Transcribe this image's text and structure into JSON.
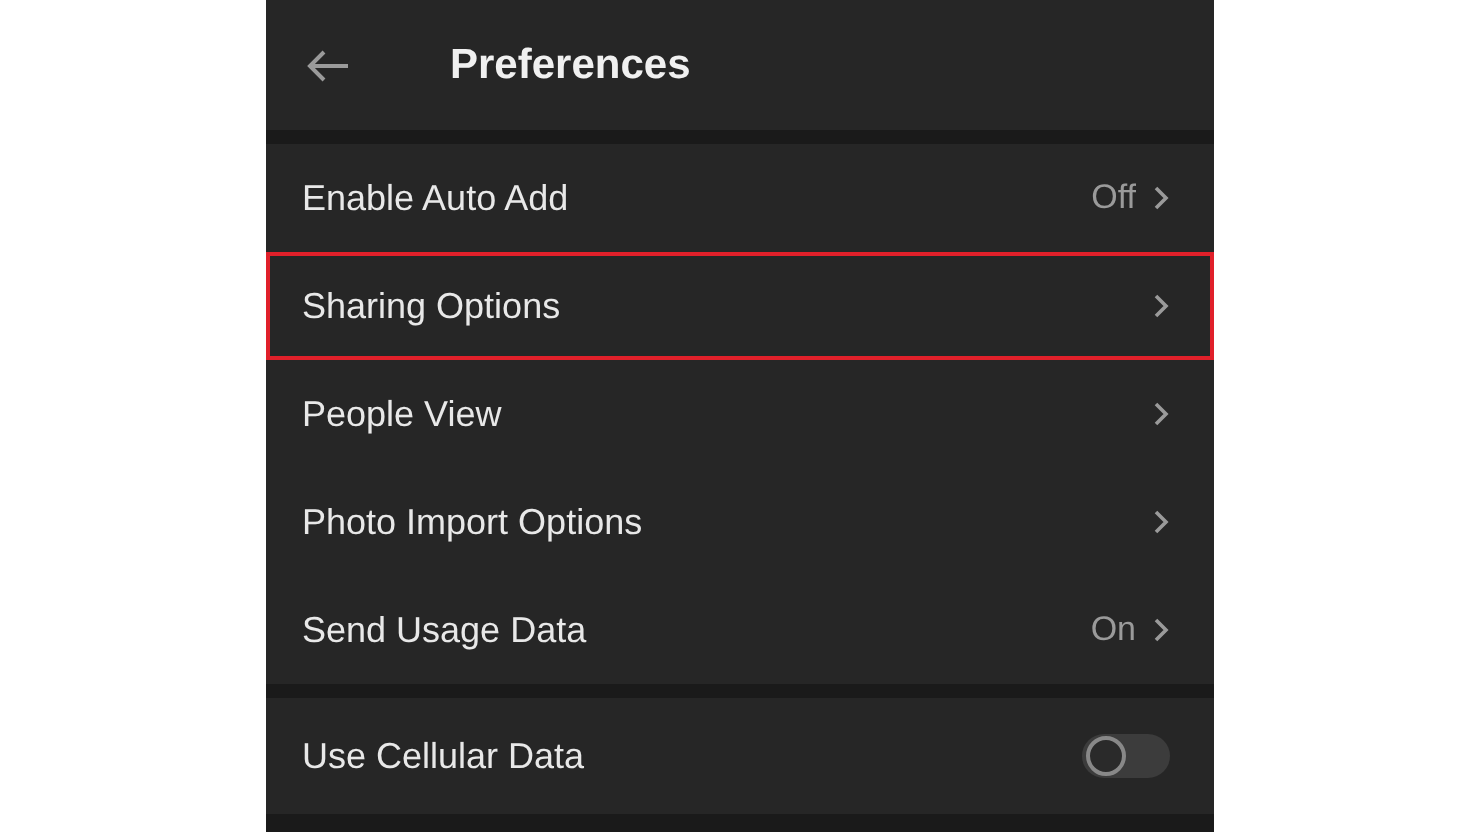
{
  "header": {
    "title": "Preferences"
  },
  "sections": [
    {
      "items": [
        {
          "kind": "link",
          "label": "Enable Auto Add",
          "value": "Off",
          "highlighted": false
        },
        {
          "kind": "link",
          "label": "Sharing Options",
          "highlighted": true
        },
        {
          "kind": "link",
          "label": "People View",
          "highlighted": false
        },
        {
          "kind": "link",
          "label": "Photo Import Options",
          "highlighted": false
        },
        {
          "kind": "link",
          "label": "Send Usage Data",
          "value": "On",
          "highlighted": false
        }
      ]
    },
    {
      "items": [
        {
          "kind": "toggle",
          "label": "Use Cellular Data",
          "on": false,
          "highlighted": false
        }
      ]
    }
  ]
}
